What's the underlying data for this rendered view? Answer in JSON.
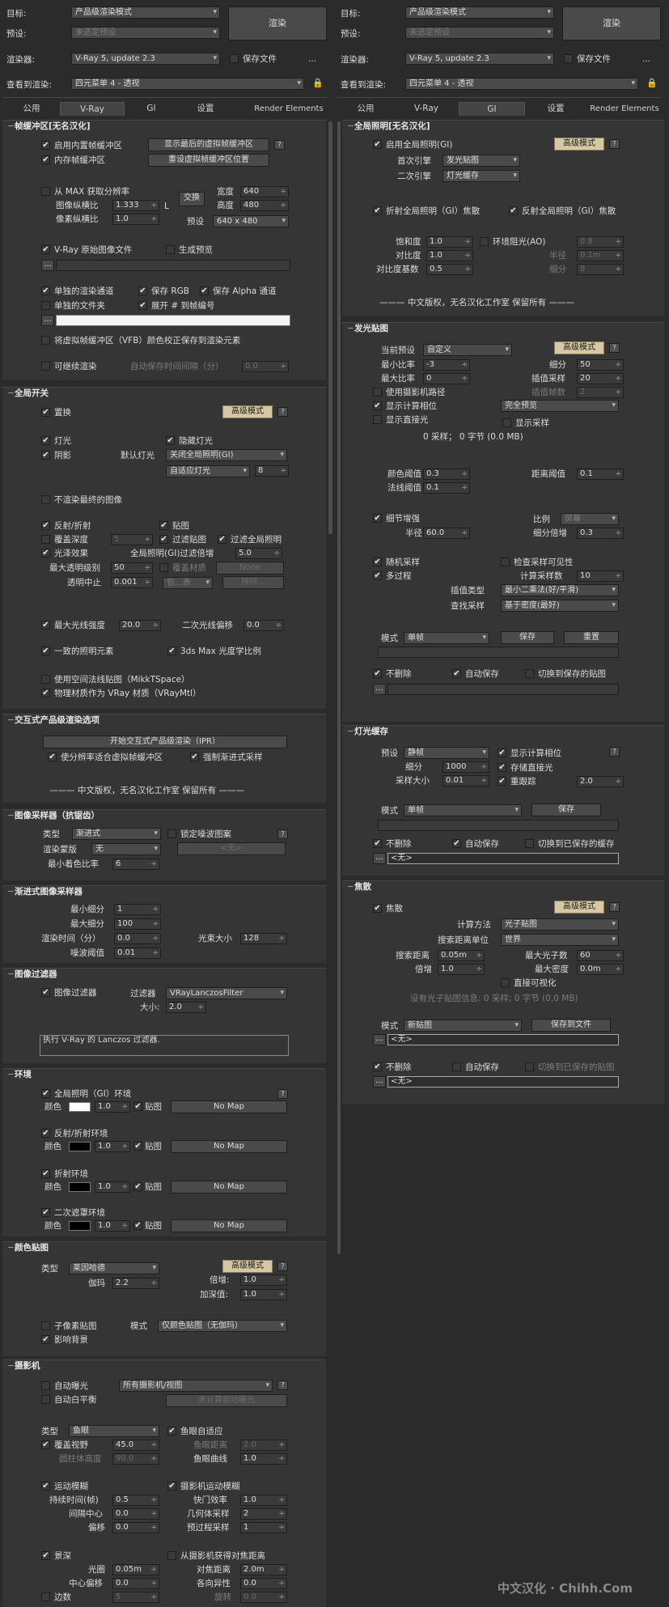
{
  "left": {
    "top": {
      "target_label": "目标:",
      "target_value": "产品级渲染模式",
      "preset_label": "预设:",
      "preset_value": "未选定预设",
      "renderer_label": "渲染器:",
      "renderer_value": "V-Ray 5, update 2.3",
      "save_file": "保存文件",
      "render_btn": "渲染",
      "view_label": "查看到渲染:",
      "view_value": "四元菜单 4 - 透视",
      "dots": "..."
    },
    "tabs": [
      "公用",
      "V-Ray",
      "GI",
      "设置",
      "Render Elements"
    ],
    "fb": {
      "title": "帧缓冲区[无名汉化]",
      "enable": "启用内置帧缓冲区",
      "show_last": "显示最后的虚拟帧缓冲区",
      "mem": "内存帧缓冲区",
      "reset": "重设虚拟帧缓冲区位置",
      "from_max": "从 MAX 获取分辨率",
      "swap": "交换",
      "aspect": "图像纵横比",
      "aspect_v": "1.333",
      "L": "L",
      "width": "宽度",
      "width_v": "640",
      "height": "高度",
      "height_v": "480",
      "px_aspect": "像素纵横比",
      "px_aspect_v": "1.0",
      "preset": "预设",
      "preset_v": "640 x 480",
      "raw": "V-Ray 原始图像文件",
      "gen_preview": "生成预览",
      "dots": "...",
      "sep_ch": "单独的渲染通道",
      "save_rgb": "保存 RGB",
      "save_alpha": "保存 Alpha 通道",
      "sep_folder": "单独的文件夹",
      "expand": "展开 # 到帧编号",
      "vfb_corr": "将虚拟帧缓冲区（VFB）颜色校正保存到渲染元素",
      "resumable": "可继续渲染",
      "autosave": "自动保存时间间隔（分）",
      "autosave_v": "0.0"
    },
    "gs": {
      "title": "全局开关",
      "displace": "置换",
      "adv": "高级模式",
      "lights": "灯光",
      "hidden": "隐藏灯光",
      "shadows": "阴影",
      "default_lights": "默认灯光",
      "default_lights_v": "关闭全局照明(GI)",
      "adaptive": "自适应灯光",
      "adaptive_v": "8",
      "no_final": "不渲染最终的图像",
      "refl": "反射/折射",
      "maps": "贴图",
      "ovr_depth": "覆盖深度",
      "ovr_depth_v": "5",
      "filter_maps": "过滤贴图",
      "filter_gi": "过滤全局照明",
      "glossy": "光泽效果",
      "gi_filter_mult": "全局照明(GI)过滤倍增",
      "gi_filter_mult_v": "5.0",
      "max_transp": "最大透明级别",
      "max_transp_v": "50",
      "ovr_mtl": "覆盖材质",
      "none": "None",
      "transp_cutoff": "透明中止",
      "transp_cutoff_v": "0.001",
      "include": "包…表",
      "exclude": "排除...",
      "max_ray": "最大光线强度",
      "max_ray_v": "20.0",
      "sec_bias": "二次光线偏移",
      "sec_bias_v": "0.0",
      "consistent": "一致的照明元素",
      "photometric": "3ds Max 光度学比例",
      "mikkt": "使用空间法线贴图（MikkTSpace）",
      "phys_mtl": "物理材质作为 VRay 材质（VRayMtl）"
    },
    "ipr": {
      "title": "交互式产品级渲染选项",
      "start": "开始交互式产品级渲染（IPR）",
      "fit": "使分辨率适合虚拟帧缓冲区",
      "force": "强制渐进式采样",
      "copyright": "——— 中文版权，无名汉化工作室 保留所有 ———"
    },
    "aa": {
      "title": "图像采样器（抗锯齿）",
      "type": "类型",
      "type_v": "渐进式",
      "lock_noise": "锁定噪波图案",
      "mask": "渲染蒙版",
      "mask_v": "无",
      "none": "<无>",
      "min_shade": "最小着色比率",
      "min_shade_v": "6"
    },
    "prog": {
      "title": "渐进式图像采样器",
      "min_sub": "最小细分",
      "min_sub_v": "1",
      "max_sub": "最大细分",
      "max_sub_v": "100",
      "time": "渲染时间（分）",
      "time_v": "0.0",
      "bundle": "光束大小",
      "bundle_v": "128",
      "noise": "噪波阈值",
      "noise_v": "0.01"
    },
    "filt": {
      "title": "图像过滤器",
      "enable": "图像过滤器",
      "filter": "过滤器",
      "filter_v": "VRayLanczosFilter",
      "size": "大小:",
      "size_v": "2.0",
      "desc": "执行 V-Ray 的 Lanczos 过滤器."
    },
    "env": {
      "title": "环境",
      "gi": "全局照明（GI）环境",
      "color": "颜色",
      "mult": "1.0",
      "map": "贴图",
      "nomap": "No Map",
      "refl": "反射/折射环境",
      "refr": "折射环境",
      "ao": "二次遮罩环境"
    },
    "cm": {
      "title": "颜色贴图",
      "type": "类型",
      "type_v": "莱因哈德",
      "adv": "高级模式",
      "gamma": "伽玛",
      "gamma_v": "2.2",
      "mult": "倍增:",
      "mult_v": "1.0",
      "burn": "加深值:",
      "burn_v": "1.0",
      "subpx": "子像素贴图",
      "mode": "模式",
      "mode_v": "仅颜色贴图（无伽玛）",
      "affect_bg": "影响背景"
    },
    "cam": {
      "title": "摄影机",
      "auto_exp": "自动曝光",
      "all_cams": "所有摄影机/视图",
      "auto_wb": "自动白平衡",
      "not_calc": "未计算自动曝光",
      "type": "类型",
      "type_v": "鱼眼",
      "fisheye_auto": "鱼眼自适应",
      "fov": "覆盖视野",
      "fov_v": "45.0",
      "fish_dist": "鱼眼距离",
      "fish_dist_v": "2.0",
      "cyl_h": "圆柱体高度",
      "cyl_h_v": "90.0",
      "fish_curve": "鱼眼曲线",
      "fish_curve_v": "1.0",
      "motion_blur": "运动模糊",
      "cam_motion": "摄影机运动模糊",
      "duration": "持续时间(帧)",
      "duration_v": "0.5",
      "shutter_eff": "快门效率",
      "shutter_eff_v": "1.0",
      "interval": "间隔中心",
      "interval_v": "0.0",
      "geo_samples": "几何体采样",
      "geo_samples_v": "2",
      "bias": "偏移",
      "bias_v": "0.0",
      "prepass": "预过程采样",
      "prepass_v": "1",
      "dof": "景深",
      "from_cam": "从摄影机获得对焦距离",
      "aperture": "光圈",
      "aperture_v": "0.05m",
      "focus": "对焦距离",
      "focus_v": "2.0m",
      "center_bias": "中心偏移",
      "center_bias_v": "0.0",
      "anisotropy": "各向异性",
      "anisotropy_v": "0.0",
      "sides": "边数",
      "sides_v": "5",
      "rotation": "旋转",
      "rotation_v": "0.0"
    }
  },
  "right": {
    "top": {
      "target_label": "目标:",
      "target_value": "产品级渲染模式",
      "preset_label": "预设:",
      "preset_value": "未选定预设",
      "renderer_label": "渲染器:",
      "renderer_value": "V-Ray 5, update 2.3",
      "save_file": "保存文件",
      "render_btn": "渲染",
      "view_label": "查看到渲染:",
      "view_value": "四元菜单 4 - 透视",
      "dots": "..."
    },
    "tabs": [
      "公用",
      "V-Ray",
      "GI",
      "设置",
      "Render Elements"
    ],
    "gi": {
      "title": "全局照明[无名汉化]",
      "enable": "启用全局照明(GI)",
      "adv": "高级模式",
      "primary": "首次引擎",
      "primary_v": "发光贴图",
      "secondary": "二次引擎",
      "secondary_v": "灯光缓存",
      "refr_caus": "折射全局照明（GI）焦散",
      "refl_caus": "反射全局照明（GI）焦散",
      "sat": "饱和度",
      "sat_v": "1.0",
      "ao": "环境阻光(AO)",
      "ao_v": "0.8",
      "contrast": "对比度",
      "contrast_v": "1.0",
      "radius": "半径",
      "radius_v": "0.1m",
      "cbase": "对比度基数",
      "cbase_v": "0.5",
      "sub": "细分",
      "sub_v": "8",
      "copyright": "——— 中文版权，无名汉化工作室 保留所有 ———"
    },
    "im": {
      "title": "发光贴图",
      "cur_preset": "当前预设",
      "cur_preset_v": "自定义",
      "adv": "高级模式",
      "min_rate": "最小比率",
      "min_rate_v": "-3",
      "subdivs": "细分",
      "subdivs_v": "50",
      "max_rate": "最大比率",
      "max_rate_v": "0",
      "interp": "插值采样",
      "interp_v": "20",
      "interp_fr": "插值帧数",
      "interp_fr_v": "2",
      "use_cam": "使用摄影机路径",
      "show_calc": "显示计算相位",
      "full_prev": "完全预览",
      "show_direct": "显示直接光",
      "show_samples": "显示采样",
      "stats": "0 采样； 0 字节 (0.0 MB)",
      "clr_th": "颜色阈值",
      "clr_th_v": "0.3",
      "dist_th": "距离阈值",
      "dist_th_v": "0.1",
      "nrm_th": "法线阈值",
      "nrm_th_v": "0.1",
      "detail": "细节增强",
      "scale": "比例",
      "scale_v": "屏幕",
      "radius": "半径",
      "radius_v": "60.0",
      "sub_mult": "细分倍增",
      "sub_mult_v": "0.3",
      "rand": "随机采样",
      "check_vis": "检查采样可见性",
      "multipass": "多过程",
      "calc_samples": "计算采样数",
      "calc_samples_v": "10",
      "interp_type": "插值类型",
      "interp_type_v": "最小二乘法(好/平滑)",
      "lookup": "查找采样",
      "lookup_v": "基于密度(最好)",
      "mode": "模式",
      "mode_v": "单帧",
      "save": "保存",
      "reset": "重置",
      "dont_del": "不删除",
      "auto_save": "自动保存",
      "switch": "切换到保存的贴图"
    },
    "lc": {
      "title": "灯光缓存",
      "preset": "预设",
      "preset_v": "静帧",
      "show_calc": "显示计算相位",
      "subdivs": "细分",
      "subdivs_v": "1000",
      "store_direct": "存储直接光",
      "sample_size": "采样大小",
      "sample_size_v": "0.01",
      "retrace": "重跟踪",
      "retrace_v": "2.0",
      "mode": "模式",
      "mode_v": "单帧",
      "save": "保存",
      "dont_del": "不删除",
      "auto_save": "自动保存",
      "switch": "切换到已保存的缓存",
      "none": "<无>"
    },
    "caus": {
      "title": "焦散",
      "enable": "焦散",
      "adv": "高级模式",
      "method": "计算方法",
      "method_v": "光子贴图",
      "units": "搜索距离单位",
      "units_v": "世界",
      "search": "搜索距离",
      "search_v": "0.05m",
      "max_ph": "最大光子数",
      "max_ph_v": "60",
      "mult": "倍增",
      "mult_v": "1.0",
      "max_dens": "最大密度",
      "max_dens_v": "0.0m",
      "direct_vis": "直接可视化",
      "info": "没有光子贴图信息: 0 采样; 0 字节 (0.0 MB)",
      "mode": "模式",
      "mode_v": "新贴图",
      "save": "保存到文件",
      "none": "<无>",
      "dont_del": "不删除",
      "auto_save": "自动保存",
      "switch": "切换到已保存的贴图"
    }
  },
  "watermark": "中文汉化 · Chihh.Com"
}
